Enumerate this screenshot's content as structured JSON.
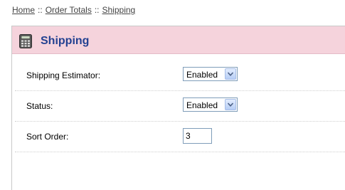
{
  "breadcrumb": {
    "items": [
      "Home",
      "Order Totals",
      "Shipping"
    ],
    "separator": "::"
  },
  "heading": {
    "title": "Shipping",
    "icon": "calculator-icon",
    "background": "#f5d3dc",
    "title_color": "#234191"
  },
  "form": {
    "shipping_estimator": {
      "label": "Shipping Estimator:",
      "value": "Enabled"
    },
    "status": {
      "label": "Status:",
      "value": "Enabled"
    },
    "sort_order": {
      "label": "Sort Order:",
      "value": "3"
    }
  }
}
